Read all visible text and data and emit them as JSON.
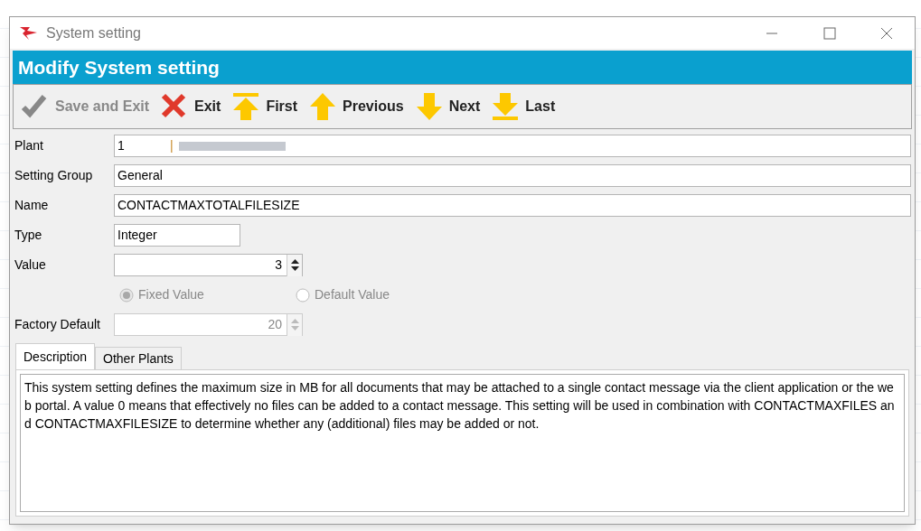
{
  "window": {
    "title": "System setting"
  },
  "header": {
    "title": "Modify System setting"
  },
  "toolbar": [
    {
      "kind": "save",
      "label": "Save and Exit",
      "disabled": true
    },
    {
      "kind": "exit",
      "label": "Exit",
      "disabled": false
    },
    {
      "kind": "first",
      "label": "First",
      "disabled": false
    },
    {
      "kind": "previous",
      "label": "Previous",
      "disabled": false
    },
    {
      "kind": "next",
      "label": "Next",
      "disabled": false
    },
    {
      "kind": "last",
      "label": "Last",
      "disabled": false
    }
  ],
  "fields": [
    {
      "kind": "plant",
      "label": "Plant",
      "value": "1",
      "separator": "|"
    },
    {
      "kind": "text",
      "label": "Setting Group",
      "value": "General"
    },
    {
      "kind": "text",
      "label": "Name",
      "value": "CONTACTMAXTOTALFILESIZE"
    },
    {
      "kind": "short",
      "label": "Type",
      "value": "Integer"
    },
    {
      "kind": "spinner",
      "label": "Value",
      "value": "3",
      "disabled": false
    }
  ],
  "value_source": [
    {
      "label": "Fixed Value",
      "selected": true,
      "disabled": true
    },
    {
      "label": "Default Value",
      "selected": false,
      "disabled": true
    }
  ],
  "factory_default": {
    "label": "Factory Default",
    "value": "20",
    "disabled": true
  },
  "tabs": [
    {
      "label": "Description",
      "selected": true
    },
    {
      "label": "Other Plants",
      "selected": false
    }
  ],
  "description": "This system setting defines the maximum size in MB for all documents that may be attached to a single contact message via the client application or the web portal. A value 0 means that effectively no files can be added to a contact message. This setting will be used in combination with CONTACTMAXFILES and CONTACTMAXFILESIZE to determine whether any (additional) files may be added or not."
}
